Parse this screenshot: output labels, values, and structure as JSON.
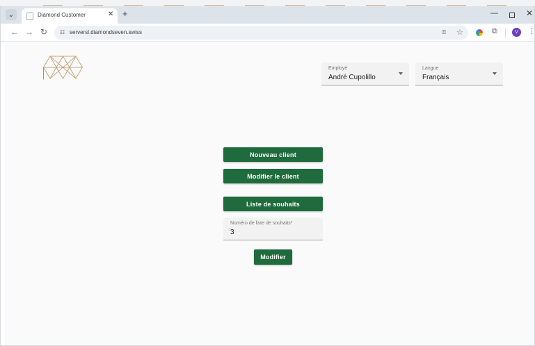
{
  "browser": {
    "tab": {
      "title": "Diamond Customer"
    },
    "url": "serversl.diamondseven.swiss",
    "profile_initial": "V"
  },
  "icons": {
    "tab_menu": "chevron-down-icon",
    "tab_close": "close-icon",
    "new_tab": "plus-icon",
    "back": "arrow-left-icon",
    "forward": "arrow-right-icon",
    "reload": "reload-icon",
    "site_info": "tune-icon",
    "password": "key-icon",
    "bookmark": "star-icon",
    "extensions": "puzzle-icon",
    "menu": "more-vertical-icon"
  },
  "page": {
    "employee": {
      "label": "Employé",
      "value": "André Cupolillo"
    },
    "language": {
      "label": "Langue",
      "value": "Français"
    },
    "buttons": {
      "new_client": "Nouveau client",
      "edit_client": "Modifier le client",
      "wishlist": "Liste de souhaits",
      "modify": "Modifier"
    },
    "wishlist_number": {
      "label": "Numéro de liste de souhaits*",
      "value": "3"
    }
  },
  "colors": {
    "primary_green": "#1f6b3d",
    "logo_gold": "#c9a27c",
    "field_background": "#f2f2f2",
    "page_background": "#fafafa"
  }
}
